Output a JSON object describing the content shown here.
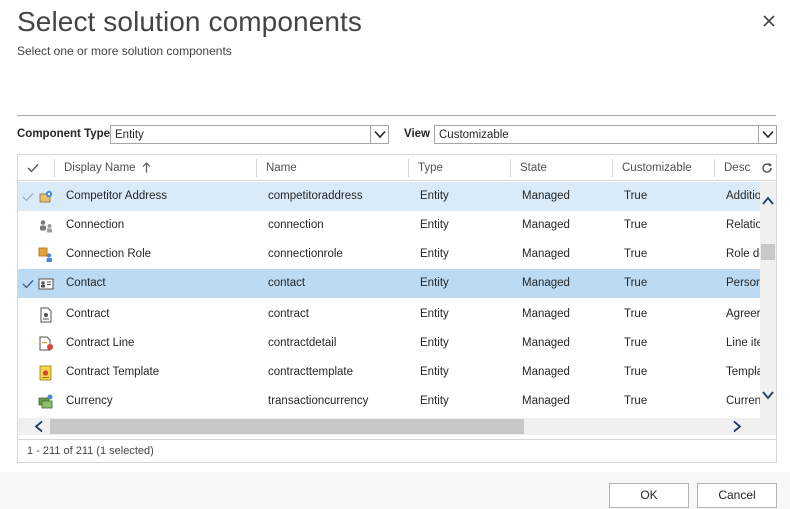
{
  "dialog": {
    "title": "Select solution components",
    "subtitle": "Select one or more solution components",
    "ok_label": "OK",
    "cancel_label": "Cancel"
  },
  "filters": {
    "component_type_label": "Component Type",
    "component_type_value": "Entity",
    "view_label": "View",
    "view_value": "Customizable"
  },
  "grid": {
    "columns": [
      "Display Name",
      "Name",
      "Type",
      "State",
      "Customizable",
      "Desc"
    ],
    "sorted_column": "Display Name",
    "sort_direction": "ascending",
    "rows": [
      {
        "display_name": "Competitor Address",
        "name": "competitoraddress",
        "type": "Entity",
        "state": "Managed",
        "customizable": "True",
        "desc": "Additio",
        "icon": "competitor-address-icon",
        "highlighted": true,
        "selected": false
      },
      {
        "display_name": "Connection",
        "name": "connection",
        "type": "Entity",
        "state": "Managed",
        "customizable": "True",
        "desc": "Relatio",
        "icon": "connection-icon",
        "highlighted": false,
        "selected": false
      },
      {
        "display_name": "Connection Role",
        "name": "connectionrole",
        "type": "Entity",
        "state": "Managed",
        "customizable": "True",
        "desc": "Role de",
        "icon": "connection-role-icon",
        "highlighted": false,
        "selected": false
      },
      {
        "display_name": "Contact",
        "name": "contact",
        "type": "Entity",
        "state": "Managed",
        "customizable": "True",
        "desc": "Person",
        "icon": "contact-icon",
        "highlighted": false,
        "selected": true
      },
      {
        "display_name": "Contract",
        "name": "contract",
        "type": "Entity",
        "state": "Managed",
        "customizable": "True",
        "desc": "Agreer",
        "icon": "contract-icon",
        "highlighted": false,
        "selected": false
      },
      {
        "display_name": "Contract Line",
        "name": "contractdetail",
        "type": "Entity",
        "state": "Managed",
        "customizable": "True",
        "desc": "Line ite",
        "icon": "contract-line-icon",
        "highlighted": false,
        "selected": false
      },
      {
        "display_name": "Contract Template",
        "name": "contracttemplate",
        "type": "Entity",
        "state": "Managed",
        "customizable": "True",
        "desc": "Templa",
        "icon": "contract-template-icon",
        "highlighted": false,
        "selected": false
      },
      {
        "display_name": "Currency",
        "name": "transactioncurrency",
        "type": "Entity",
        "state": "Managed",
        "customizable": "True",
        "desc": "Curren",
        "icon": "currency-icon",
        "highlighted": false,
        "selected": false
      }
    ],
    "footer_status": "1 - 211 of 211 (1 selected)"
  },
  "colors": {
    "row_highlight": "#d9ebf8",
    "row_selected": "#bcdaf2",
    "border": "#a6a6a6",
    "title_text": "#444444"
  }
}
